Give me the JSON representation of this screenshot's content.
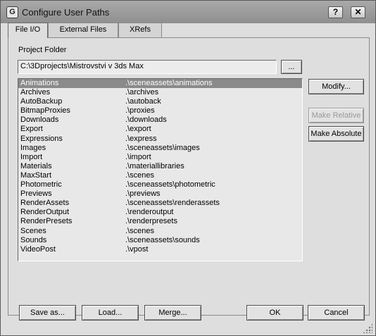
{
  "window": {
    "title": "Configure User Paths",
    "help_label": "?",
    "close_label": "✕",
    "icon_label": "G"
  },
  "tabs": [
    {
      "label": "File I/O",
      "active": true
    },
    {
      "label": "External Files",
      "active": false
    },
    {
      "label": "XRefs",
      "active": false
    }
  ],
  "project": {
    "label": "Project Folder",
    "value": "C:\\3Dprojects\\Mistrovstvi v 3ds Max",
    "browse_label": "..."
  },
  "paths": [
    {
      "name": "Animations",
      "path": ".\\sceneassets\\animations",
      "selected": true
    },
    {
      "name": "Archives",
      "path": ".\\archives"
    },
    {
      "name": "AutoBackup",
      "path": ".\\autoback"
    },
    {
      "name": "BitmapProxies",
      "path": ".\\proxies"
    },
    {
      "name": "Downloads",
      "path": ".\\downloads"
    },
    {
      "name": "Export",
      "path": ".\\export"
    },
    {
      "name": "Expressions",
      "path": ".\\express"
    },
    {
      "name": "Images",
      "path": ".\\sceneassets\\images"
    },
    {
      "name": "Import",
      "path": ".\\import"
    },
    {
      "name": "Materials",
      "path": ".\\materiallibraries"
    },
    {
      "name": "MaxStart",
      "path": ".\\scenes"
    },
    {
      "name": "Photometric",
      "path": ".\\sceneassets\\photometric"
    },
    {
      "name": "Previews",
      "path": ".\\previews"
    },
    {
      "name": "RenderAssets",
      "path": ".\\sceneassets\\renderassets"
    },
    {
      "name": "RenderOutput",
      "path": ".\\renderoutput"
    },
    {
      "name": "RenderPresets",
      "path": ".\\renderpresets"
    },
    {
      "name": "Scenes",
      "path": ".\\scenes"
    },
    {
      "name": "Sounds",
      "path": ".\\sceneassets\\sounds"
    },
    {
      "name": "VideoPost",
      "path": ".\\vpost"
    }
  ],
  "side_buttons": {
    "modify": "Modify...",
    "make_relative": "Make Relative",
    "make_absolute": "Make Absolute"
  },
  "bottom_buttons": {
    "save": "Save as...",
    "load": "Load...",
    "merge": "Merge...",
    "ok": "OK",
    "cancel": "Cancel"
  },
  "icons": {
    "app": "app-icon",
    "help": "help-icon",
    "close": "close-icon",
    "resize": "resize-grip-icon"
  }
}
